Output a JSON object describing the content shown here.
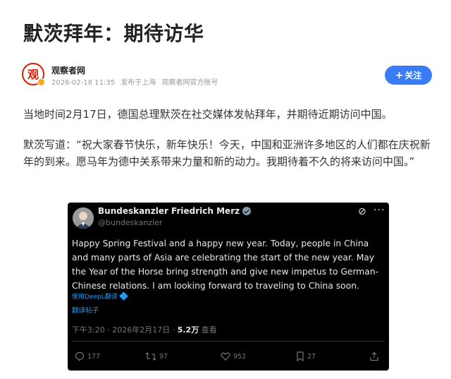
{
  "article": {
    "title": "默茨拜年：期待访华",
    "author": {
      "name": "观察者网",
      "datetime": "2026-02-18 11:35",
      "location": "发布于上海",
      "account_type": "观察者网官方账号"
    },
    "follow_label": "关注",
    "paragraphs": [
      "当地时间2月17日，德国总理默茨在社交媒体发帖拜年，并期待近期访问中国。",
      "默茨写道：“祝大家春节快乐，新年快乐！今天，中国和亚洲许多地区的人们都在庆祝新年的到来。愿马年为德中关系带来力量和新的动力。我期待着不久的将来访问中国。”"
    ]
  },
  "tweet": {
    "display_name": "Bundeskanzler Friedrich Merz",
    "handle": "@bundeskanzler",
    "text": "Happy Spring Festival and a happy new year. Today, people in China and many parts of Asia are celebrating the start of the new year. May the Year of the Horse bring strength and give new impetus to German-Chinese relations. I am looking forward to traveling to China soon.",
    "translated_with": "使用DeepL翻译",
    "translate_post": "翻译帖子",
    "time": "下午3:20",
    "date": "2026年2月17日",
    "views_count": "5.2万",
    "views_label": "查看",
    "replies": "177",
    "reposts": "97",
    "likes": "952",
    "bookmarks": "27"
  },
  "colors": {
    "accent_blue": "#3a7cf5",
    "brand_red": "#d81e06",
    "tweet_bg": "#000000",
    "link_blue": "#1d9bf0"
  }
}
